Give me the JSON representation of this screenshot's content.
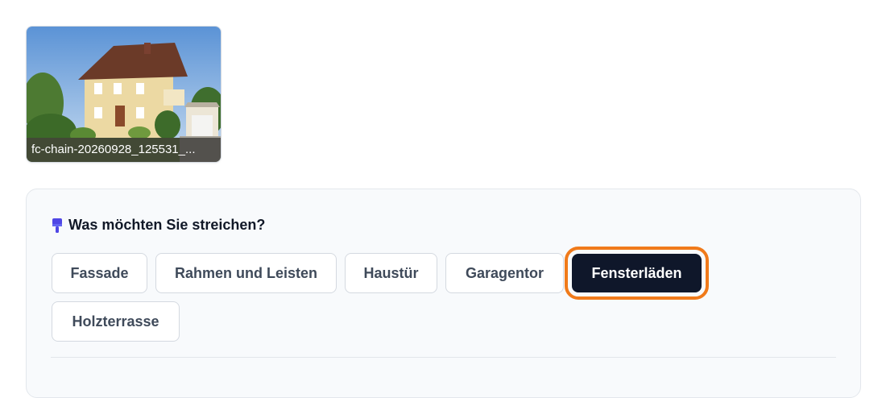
{
  "attachment": {
    "filename": "fc-chain-20260928_125531_...",
    "image_subject": "house-photo"
  },
  "question": {
    "icon": "paintbrush-icon",
    "title": "Was möchten Sie streichen?"
  },
  "options": [
    {
      "label": "Fassade",
      "selected": false
    },
    {
      "label": "Rahmen und Leisten",
      "selected": false
    },
    {
      "label": "Haustür",
      "selected": false
    },
    {
      "label": "Garagentor",
      "selected": false
    },
    {
      "label": "Fensterläden",
      "selected": true
    },
    {
      "label": "Holzterrasse",
      "selected": false
    }
  ],
  "colors": {
    "selected_bg": "#0f172a",
    "focus_ring": "#f07a1a",
    "icon": "#4f46e5"
  }
}
